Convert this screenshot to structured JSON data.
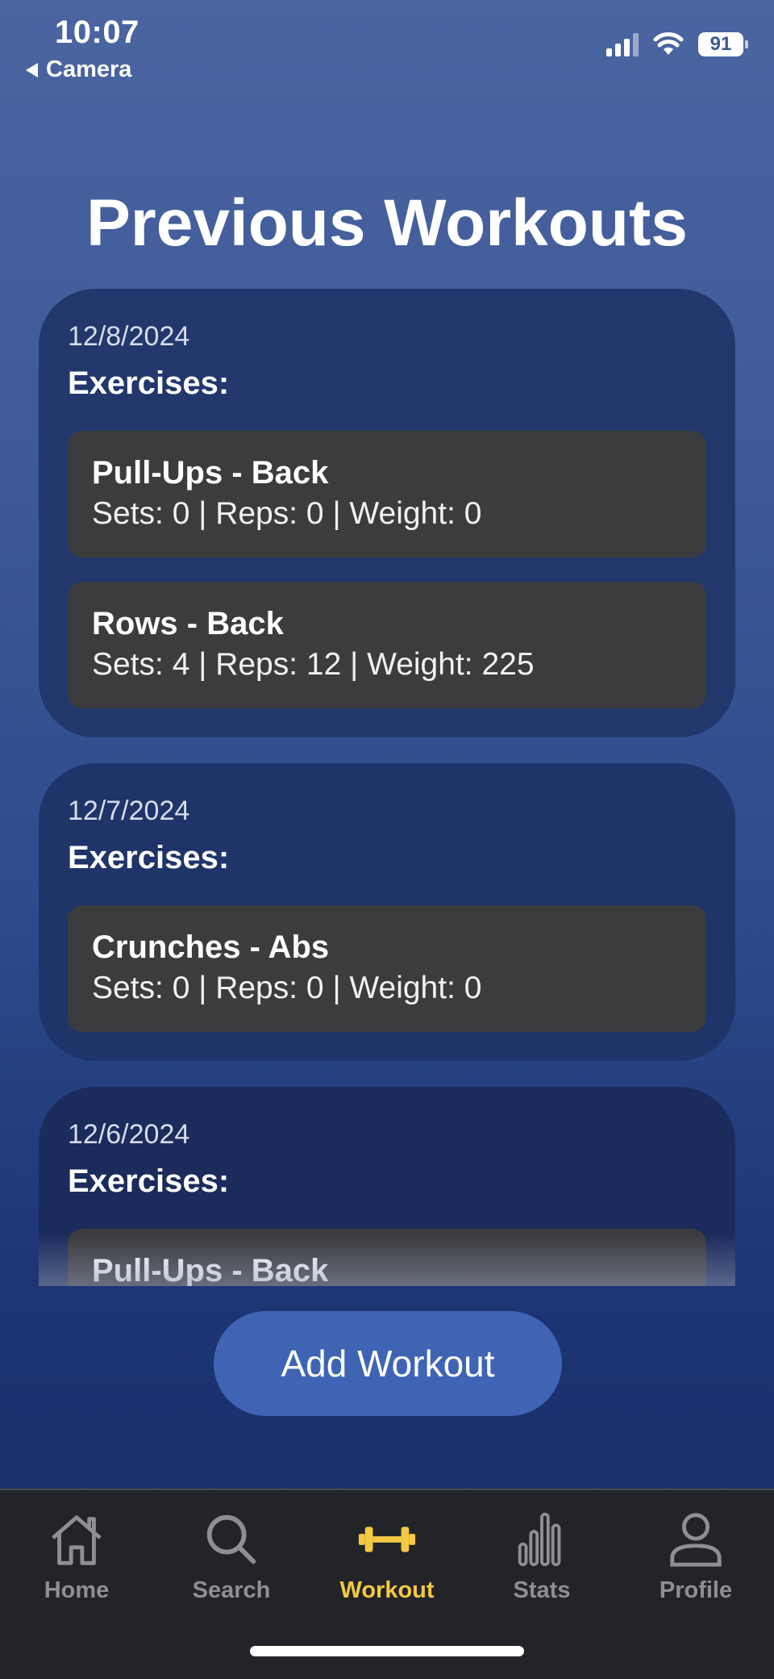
{
  "status_bar": {
    "time": "10:07",
    "back_app": "Camera",
    "battery": "91"
  },
  "page": {
    "title": "Previous Workouts"
  },
  "workouts": [
    {
      "date": "12/8/2024",
      "heading": "Exercises:",
      "exercises": [
        {
          "name": "Pull-Ups - Back",
          "detail": "Sets: 0 | Reps: 0 | Weight: 0"
        },
        {
          "name": "Rows - Back",
          "detail": "Sets: 4 | Reps: 12 | Weight: 225"
        }
      ]
    },
    {
      "date": "12/7/2024",
      "heading": "Exercises:",
      "exercises": [
        {
          "name": "Crunches - Abs",
          "detail": "Sets: 0 | Reps: 0 | Weight: 0"
        }
      ]
    },
    {
      "date": "12/6/2024",
      "heading": "Exercises:",
      "exercises": [
        {
          "name": "Pull-Ups - Back",
          "detail": ""
        }
      ]
    }
  ],
  "add_button": {
    "label": "Add Workout"
  },
  "tabs": [
    {
      "label": "Home",
      "icon": "house-icon"
    },
    {
      "label": "Search",
      "icon": "magnifier-icon"
    },
    {
      "label": "Workout",
      "icon": "dumbbell-icon",
      "active": true
    },
    {
      "label": "Stats",
      "icon": "bar-chart-icon"
    },
    {
      "label": "Profile",
      "icon": "person-icon"
    }
  ],
  "colors": {
    "active_tab": "#f3c943",
    "inactive_tab": "#8e8e93",
    "button": "#4064b4",
    "exercise_bg": "#3c3c3e"
  }
}
